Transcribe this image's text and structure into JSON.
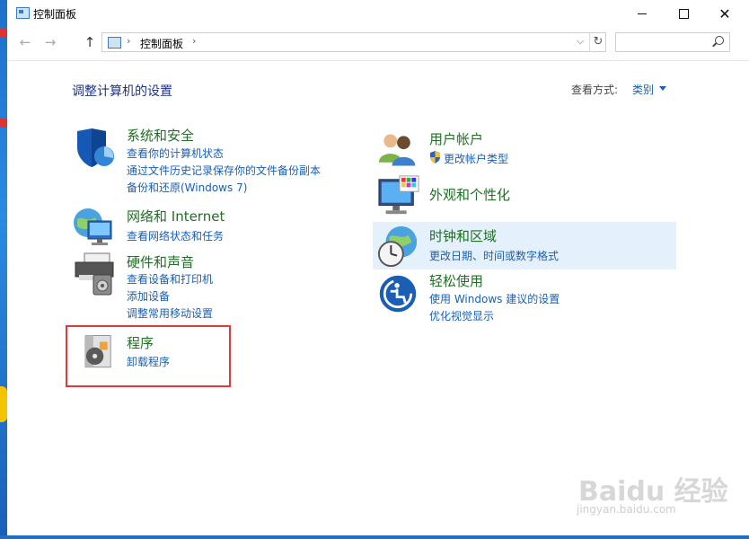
{
  "window": {
    "title": "控制面板"
  },
  "nav": {
    "back_icon": "back-arrow-icon",
    "forward_icon": "forward-arrow-icon",
    "up_icon": "up-arrow-icon",
    "address": "控制面板",
    "search_placeholder": ""
  },
  "header": {
    "title": "调整计算机的设置",
    "view_by_label": "查看方式:",
    "view_by_value": "类别"
  },
  "categories": {
    "system": {
      "title": "系统和安全",
      "icon": "shield-icon",
      "links": [
        "查看你的计算机状态",
        "通过文件历史记录保存你的文件备份副本",
        "备份和还原(Windows 7)"
      ]
    },
    "network": {
      "title": "网络和 Internet",
      "icon": "globe-network-icon",
      "links": [
        "查看网络状态和任务"
      ]
    },
    "hardware": {
      "title": "硬件和声音",
      "icon": "printer-speaker-icon",
      "links": [
        "查看设备和打印机",
        "添加设备",
        "调整常用移动设置"
      ]
    },
    "programs": {
      "title": "程序",
      "icon": "program-disc-icon",
      "links": [
        "卸载程序"
      ]
    },
    "users": {
      "title": "用户帐户",
      "icon": "users-icon",
      "links": [
        "更改帐户类型"
      ]
    },
    "appearance": {
      "title": "外观和个性化",
      "icon": "monitor-palette-icon",
      "links": []
    },
    "clock": {
      "title": "时钟和区域",
      "icon": "clock-globe-icon",
      "links": [
        "更改日期、时间或数字格式"
      ]
    },
    "ease": {
      "title": "轻松使用",
      "icon": "ease-of-access-icon",
      "links": [
        "使用 Windows 建议的设置",
        "优化视觉显示"
      ]
    }
  },
  "watermark": {
    "brand": "Baidu 经验",
    "url": "jingyan.baidu.com"
  },
  "colors": {
    "title_green": "#1f6f24",
    "link_blue": "#1a5fb4",
    "heading_blue": "#1e3287",
    "highlight_red": "#e0393e"
  }
}
